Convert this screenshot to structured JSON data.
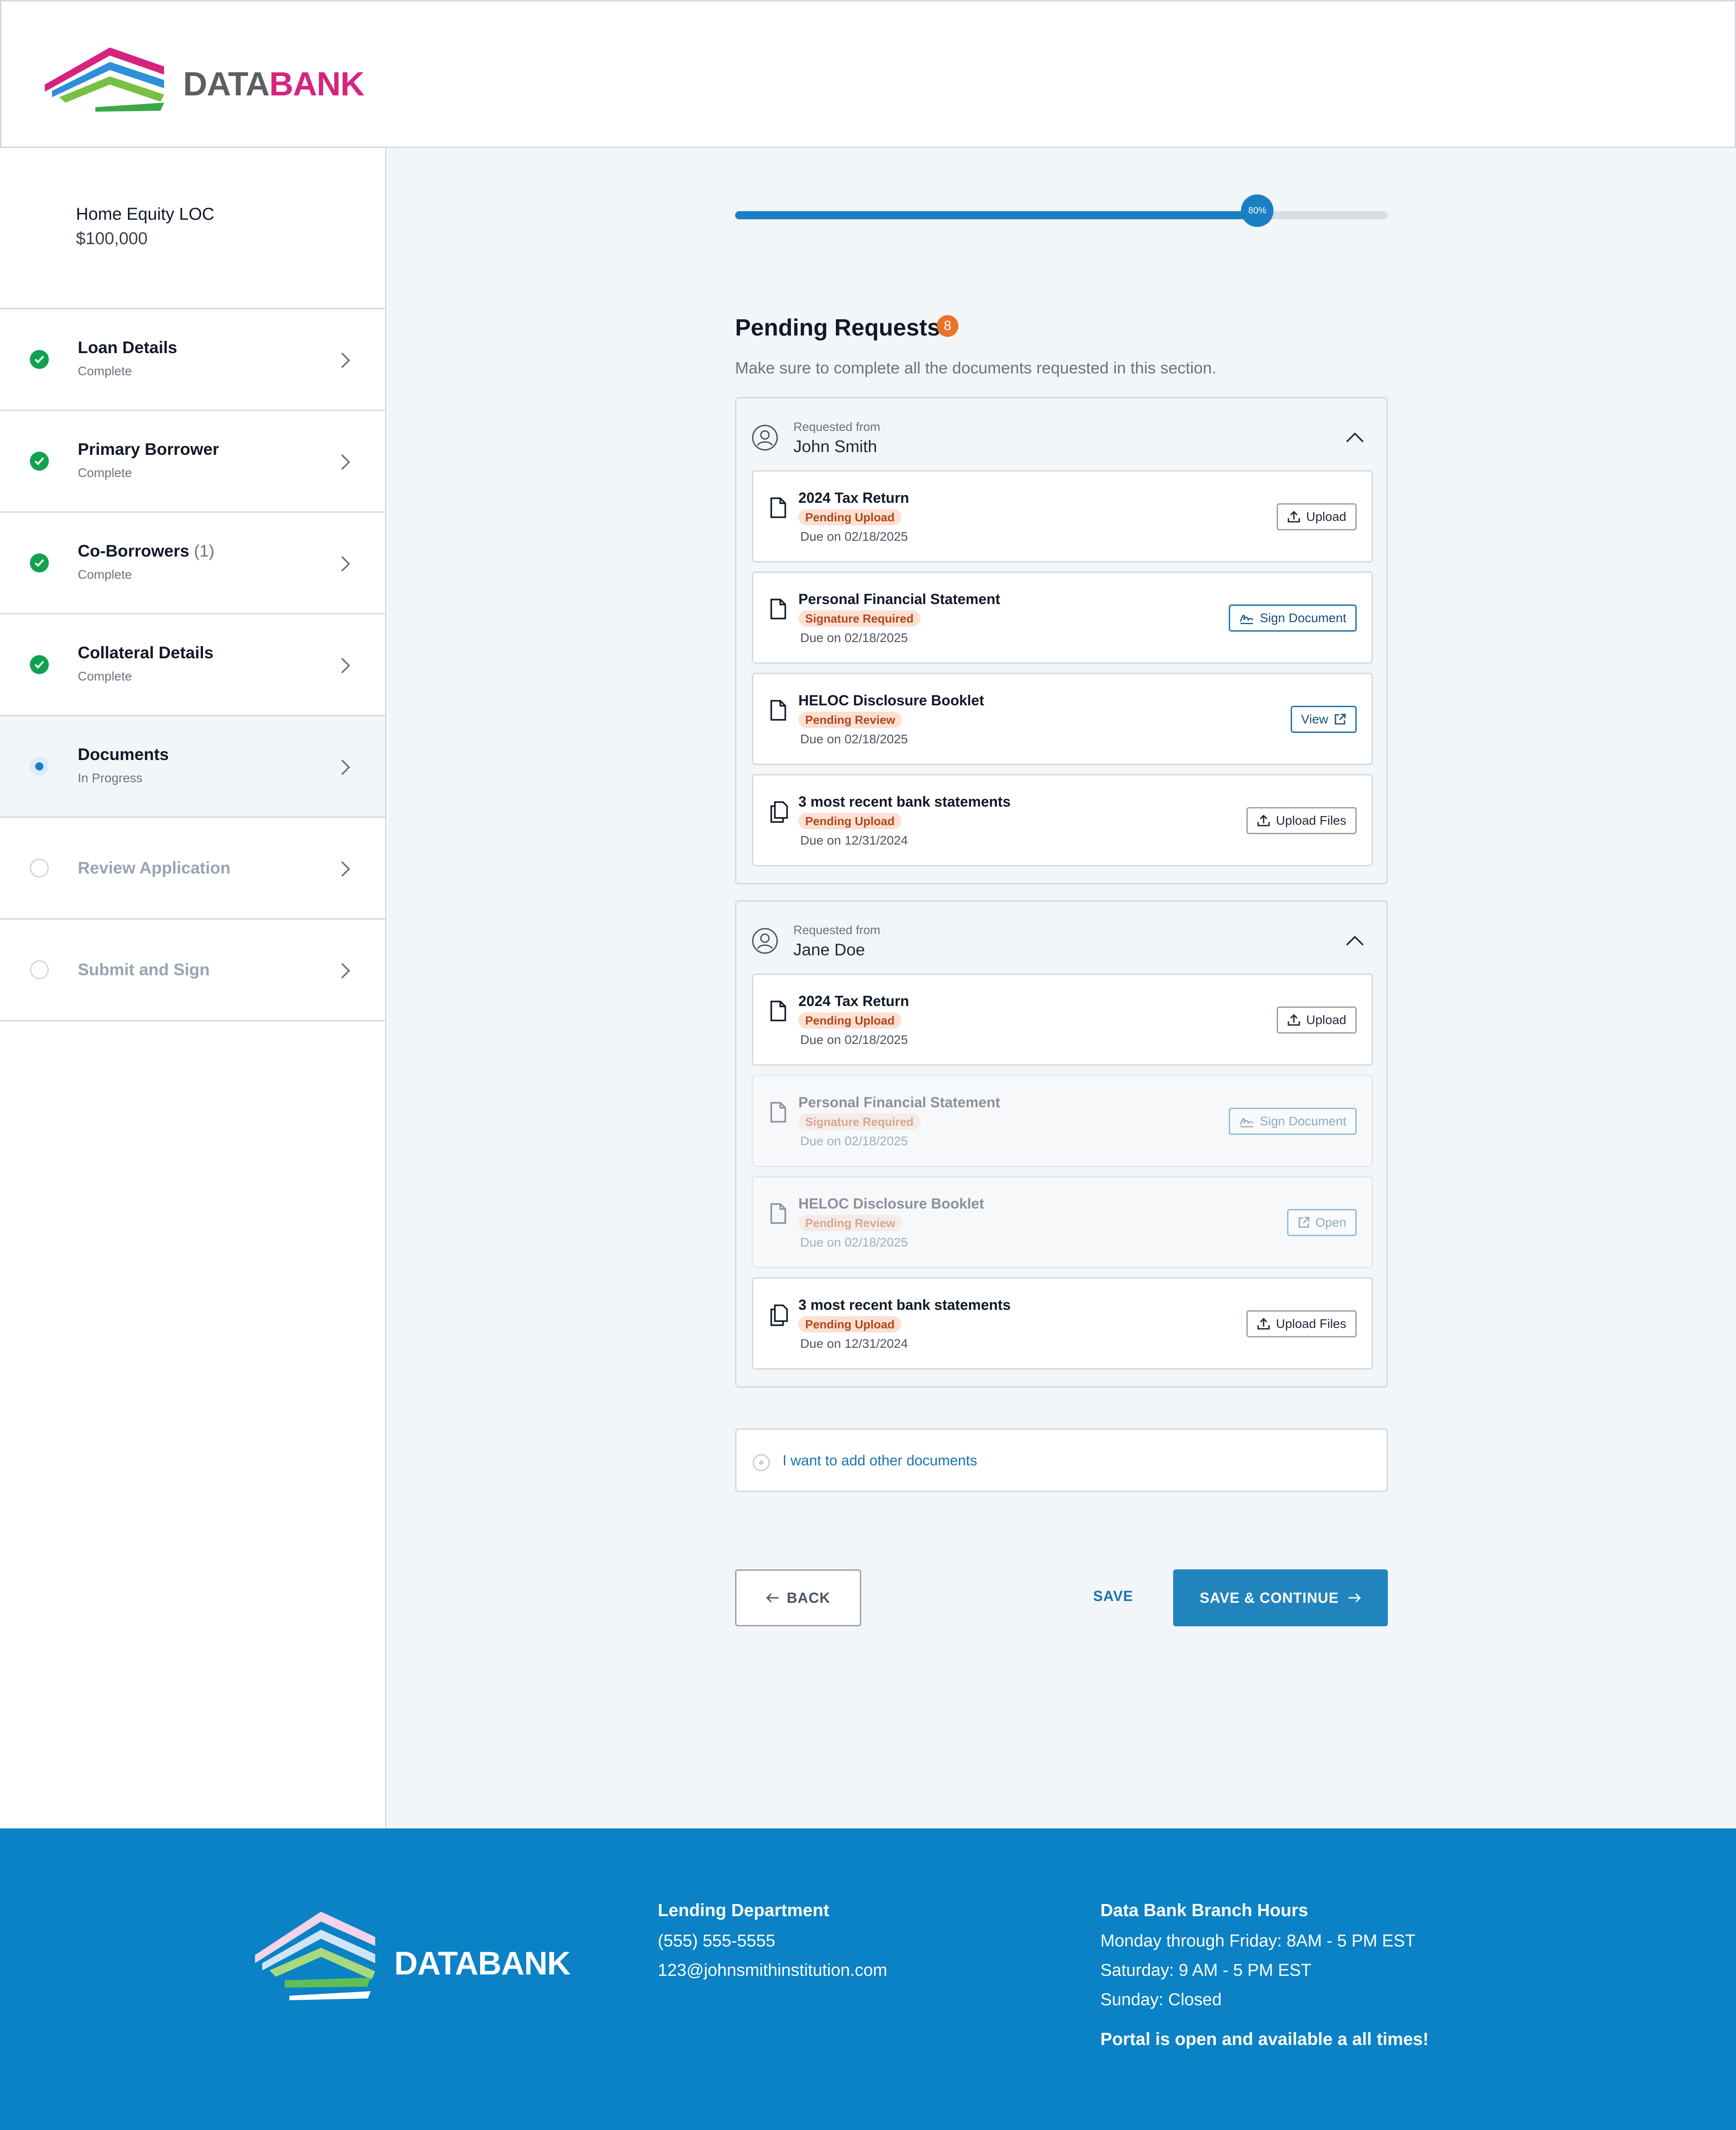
{
  "brand": {
    "name_part1": "DATA",
    "name_part2": "BANK",
    "footer_name": "DATABANK",
    "colors": {
      "magenta": "#d6237f",
      "blue": "#1b7fc4",
      "green": "#12a150",
      "footer": "#0b82c5"
    }
  },
  "loan": {
    "name": "Home Equity LOC",
    "amount": "$100,000"
  },
  "steps": [
    {
      "title": "Loan Details",
      "status": "Complete",
      "state": "done"
    },
    {
      "title": "Primary Borrower",
      "status": "Complete",
      "state": "done"
    },
    {
      "title": "Co-Borrowers",
      "count": "(1)",
      "status": "Complete",
      "state": "done"
    },
    {
      "title": "Collateral Details",
      "status": "Complete",
      "state": "done"
    },
    {
      "title": "Documents",
      "status": "In Progress",
      "state": "progress"
    },
    {
      "title": "Review Application",
      "state": "todo"
    },
    {
      "title": "Submit and Sign",
      "state": "todo"
    }
  ],
  "progress": {
    "value": 0.8,
    "label": "80%"
  },
  "pending": {
    "title": "Pending Requests",
    "count": "8",
    "description": "Make sure to complete all the documents requested in this section."
  },
  "groups": [
    {
      "requested_label": "Requested from",
      "name": "John Smith",
      "docs": [
        {
          "title": "2024 Tax Return",
          "badge": "Pending Upload",
          "due": "Due on 02/18/2025",
          "action": "Upload",
          "action_icon": "upload-icon",
          "icon": "document-icon"
        },
        {
          "title": "Personal Financial Statement",
          "badge": "Signature Required",
          "due": "Due on 02/18/2025",
          "action": "Sign Document",
          "action_icon": "signature-icon",
          "icon": "document-icon"
        },
        {
          "title": "HELOC Disclosure Booklet",
          "badge": "Pending Review",
          "due": "Due on 02/18/2025",
          "action": "View",
          "action_icon": "external-link-icon",
          "icon": "document-icon"
        },
        {
          "title": "3 most recent bank statements",
          "badge": "Pending Upload",
          "due": "Due on 12/31/2024",
          "action": "Upload Files",
          "action_icon": "upload-icon",
          "icon": "documents-stack-icon"
        }
      ]
    },
    {
      "requested_label": "Requested from",
      "name": "Jane Doe",
      "docs": [
        {
          "title": "2024 Tax Return",
          "badge": "Pending Upload",
          "due": "Due on 02/18/2025",
          "action": "Upload",
          "action_icon": "upload-icon",
          "icon": "document-icon"
        },
        {
          "title": "Personal Financial Statement",
          "badge": "Signature Required",
          "due": "Due on 02/18/2025",
          "action": "Sign Document",
          "action_icon": "signature-icon",
          "icon": "document-icon",
          "disabled": true
        },
        {
          "title": "HELOC Disclosure Booklet",
          "badge": "Pending Review",
          "due": "Due on 02/18/2025",
          "action": "Open",
          "action_icon": "external-link-icon",
          "icon": "document-icon",
          "disabled": true
        },
        {
          "title": "3 most recent bank statements",
          "badge": "Pending Upload",
          "due": "Due on 12/31/2024",
          "action": "Upload Files",
          "action_icon": "upload-icon",
          "icon": "documents-stack-icon"
        }
      ]
    }
  ],
  "add_documents": {
    "label": "I want to add other documents"
  },
  "actions": {
    "back": "BACK",
    "save": "SAVE",
    "continue": "SAVE & CONTINUE"
  },
  "footer": {
    "lending": {
      "title": "Lending Department",
      "phone": "(555) 555-5555",
      "email": "123@johnsmithinstitution.com"
    },
    "hours": {
      "title": "Data Bank Branch Hours",
      "weekday": "Monday through Friday: 8AM - 5 PM EST",
      "saturday": "Saturday: 9 AM - 5 PM EST",
      "sunday": "Sunday: Closed",
      "note": "Portal is open and available a all times!"
    }
  }
}
